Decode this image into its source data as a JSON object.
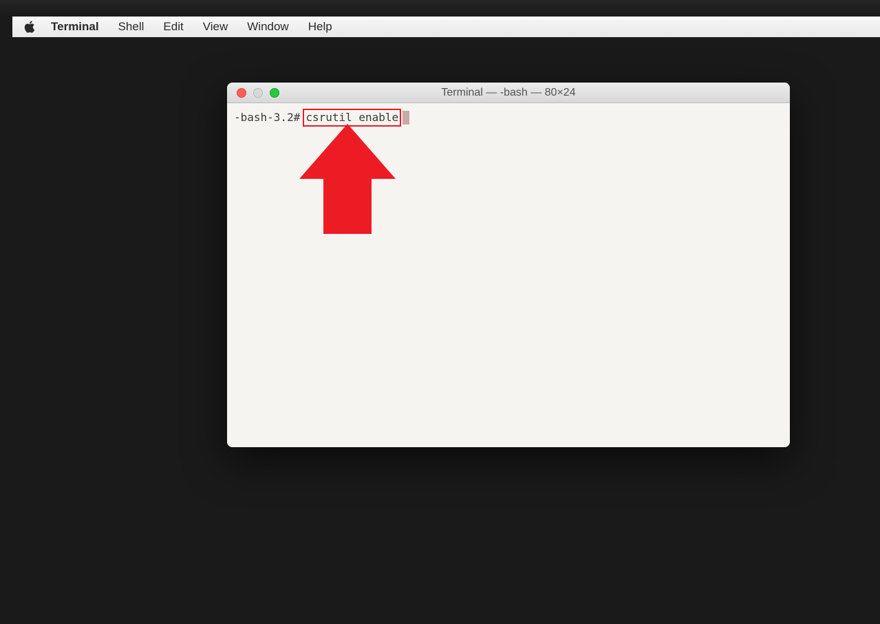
{
  "menubar": {
    "app_name": "Terminal",
    "items": [
      "Shell",
      "Edit",
      "View",
      "Window",
      "Help"
    ]
  },
  "terminal": {
    "title": "Terminal — -bash — 80×24",
    "prompt": "-bash-3.2#",
    "command": "csrutil enable"
  }
}
